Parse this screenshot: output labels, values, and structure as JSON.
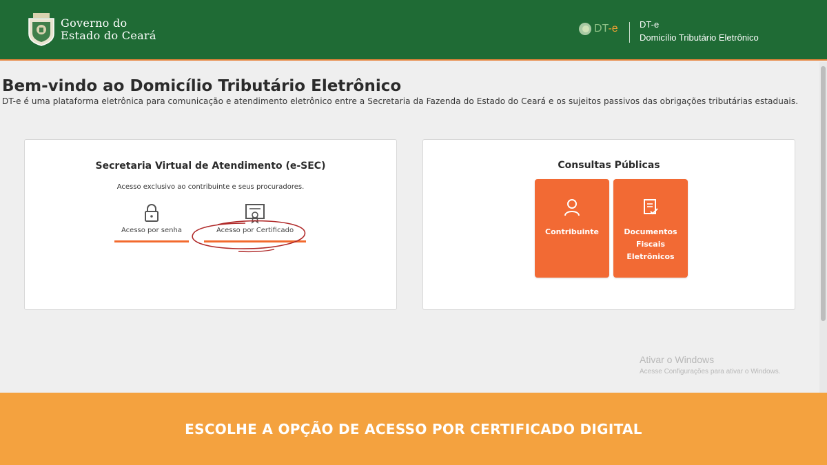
{
  "header": {
    "gov_line1": "Governo do",
    "gov_line2": "Estado do Ceará",
    "dte_mark": "DT",
    "dte_mark_e": "-e",
    "app_code": "DT-e",
    "app_name": "Domicílio Tributário Eletrônico",
    "colors": {
      "bg": "#1f6b35",
      "accent": "#e8823a"
    }
  },
  "welcome": {
    "title": "Bem-vindo ao Domicílio Tributário Eletrônico",
    "description": "DT-e é uma plataforma eletrônica para comunicação e atendimento eletrônico entre a Secretaria da Fazenda do Estado do Ceará e os sujeitos passivos das obrigações tributárias estaduais."
  },
  "esec": {
    "title": "Secretaria Virtual de Atendimento (e-SEC)",
    "subtitle": "Acesso exclusivo ao contribuinte e seus procuradores.",
    "options": [
      {
        "label": "Acesso por senha",
        "icon": "lock-icon"
      },
      {
        "label": "Acesso por Certificado",
        "icon": "certificate-icon"
      }
    ]
  },
  "consultas": {
    "title": "Consultas Públicas",
    "tiles": [
      {
        "label": "Contribuinte",
        "icon": "user-icon"
      },
      {
        "label": "Documentos Fiscais Eletrônicos",
        "icon": "document-check-icon"
      }
    ],
    "tile_color": "#f26a34"
  },
  "watermark": {
    "line1": "Ativar o Windows",
    "line2": "Acesse Configurações para ativar o Windows."
  },
  "banner": {
    "text": "ESCOLHE A OPÇÃO DE ACESSO POR CERTIFICADO DIGITAL",
    "color": "#f4a23f"
  }
}
